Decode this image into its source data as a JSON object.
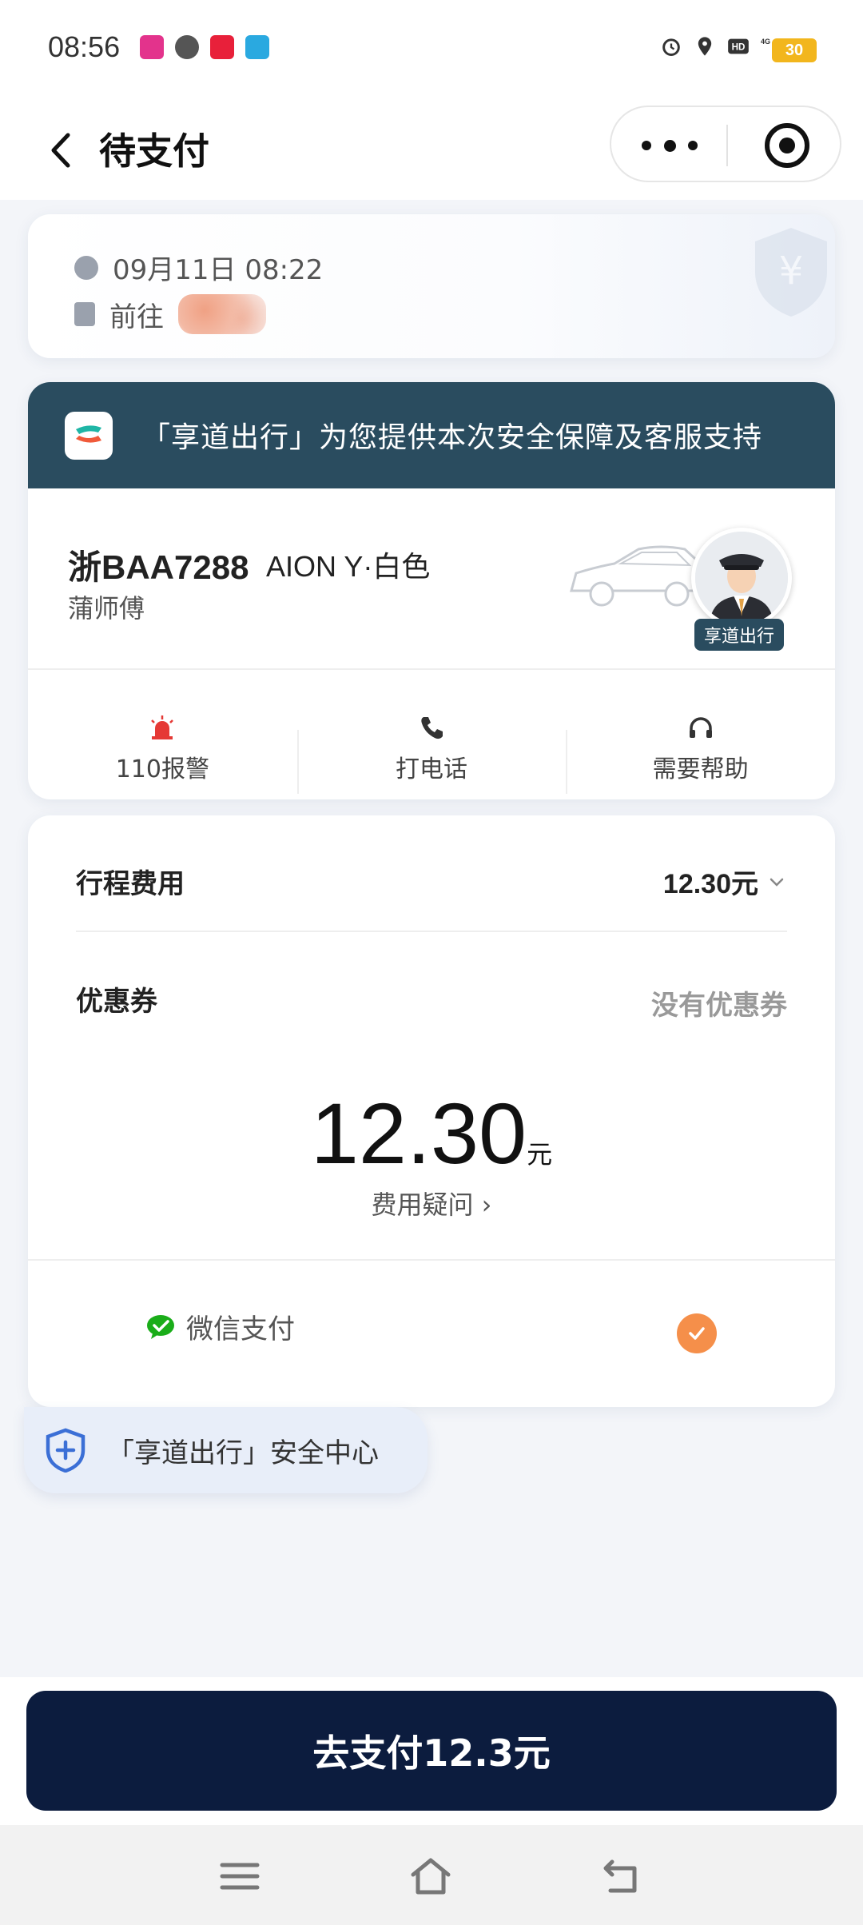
{
  "status_bar": {
    "time": "08:56",
    "battery": "30",
    "network": "4G",
    "icons": [
      "alarm-icon",
      "location-icon",
      "hd-icon",
      "signal-icon"
    ]
  },
  "nav": {
    "title": "待支付",
    "back_icon": "chevron-left-icon",
    "more_icon": "more-dots-icon",
    "capsule_icon": "target-icon"
  },
  "trip": {
    "datetime": "09月11日 08:22",
    "destination_prefix": "前往"
  },
  "driver_card": {
    "banner_text": "「享道出行」为您提供本次安全保障及客服支持",
    "plate": "浙BAA7288",
    "car_model": "AION Y·白色",
    "driver_name": "蒲师傅",
    "badge": "享道出行",
    "actions": [
      {
        "label": "110报警",
        "icon": "alarm-siren-icon",
        "color": "#e53935"
      },
      {
        "label": "打电话",
        "icon": "phone-icon",
        "color": "#333333"
      },
      {
        "label": "需要帮助",
        "icon": "headset-icon",
        "color": "#333333"
      }
    ]
  },
  "fee": {
    "trip_fee_label": "行程费用",
    "trip_fee_value": "12.30元",
    "coupon_label": "优惠券",
    "coupon_value": "没有优惠券",
    "total_amount": "12.30",
    "total_unit": "元",
    "doubt_link": "费用疑问 ›",
    "payment_method": "微信支付"
  },
  "safety_center": {
    "label": "「享道出行」安全中心"
  },
  "pay_button": {
    "label": "去支付12.3元"
  },
  "colors": {
    "banner": "#2a4c5f",
    "pay_button": "#0c1c3e",
    "check": "#f58f4a",
    "wechat": "#1aad19"
  }
}
